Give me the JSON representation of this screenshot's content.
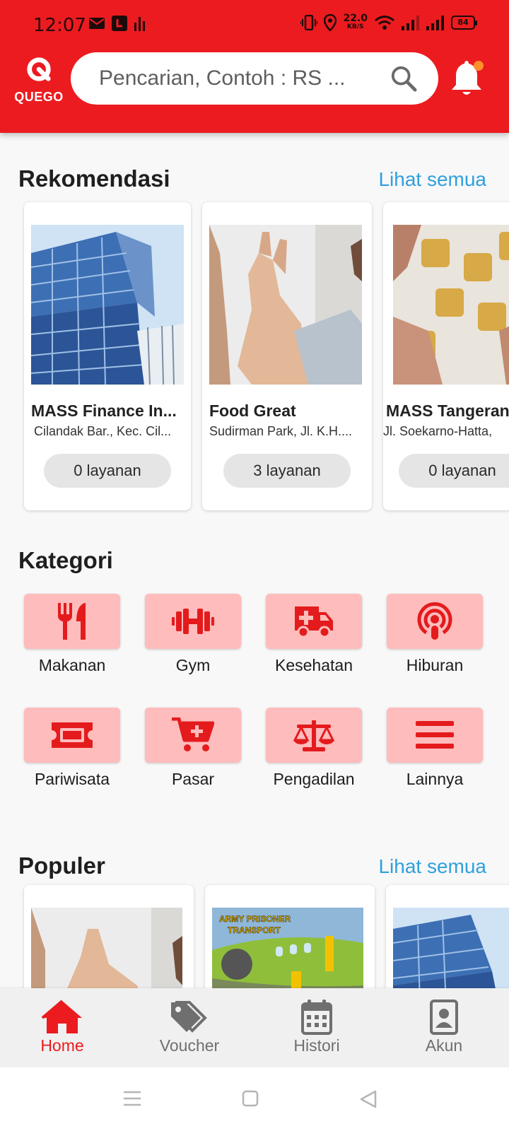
{
  "status_bar": {
    "time": "12:07",
    "net_speed_value": "22.0",
    "net_speed_unit": "KB/S",
    "battery": "84"
  },
  "header": {
    "logo_text": "QUEGO",
    "search_placeholder": "Pencarian, Contoh : RS ...",
    "accent_color": "#ec1b1f"
  },
  "recommendations": {
    "title": "Rekomendasi",
    "see_all": "Lihat semua",
    "items": [
      {
        "name": "MASS Finance In...",
        "address": "Cilandak Bar., Kec. Cil...",
        "badge": "0 layanan",
        "image": "office-building"
      },
      {
        "name": "Food Great",
        "address": "Sudirman Park, Jl. K.H....",
        "badge": "3 layanan",
        "image": "high-five"
      },
      {
        "name": "MASS Tangerang",
        "address": "Jl. Soekarno-Hatta,",
        "badge": "0 layanan",
        "image": "puzzle-hands"
      }
    ]
  },
  "categories": {
    "title": "Kategori",
    "items": [
      {
        "label": "Makanan",
        "icon": "utensils-icon"
      },
      {
        "label": "Gym",
        "icon": "dumbbell-icon"
      },
      {
        "label": "Kesehatan",
        "icon": "ambulance-icon"
      },
      {
        "label": "Hiburan",
        "icon": "podcast-icon"
      },
      {
        "label": "Pariwisata",
        "icon": "ticket-icon"
      },
      {
        "label": "Pasar",
        "icon": "cart-plus-icon"
      },
      {
        "label": "Pengadilan",
        "icon": "scale-icon"
      },
      {
        "label": "Lainnya",
        "icon": "menu-icon"
      }
    ]
  },
  "popular": {
    "title": "Populer",
    "see_all": "Lihat semua",
    "items": [
      {
        "image": "high-five"
      },
      {
        "image": "army-prisoner-transport",
        "caption": "ARMY PRISONER TRANSPORT"
      },
      {
        "image": "office-building"
      }
    ]
  },
  "bottom_nav": {
    "items": [
      {
        "label": "Home",
        "icon": "home-icon",
        "active": true
      },
      {
        "label": "Voucher",
        "icon": "tags-icon",
        "active": false
      },
      {
        "label": "Histori",
        "icon": "calendar-icon",
        "active": false
      },
      {
        "label": "Akun",
        "icon": "id-badge-icon",
        "active": false
      }
    ]
  }
}
